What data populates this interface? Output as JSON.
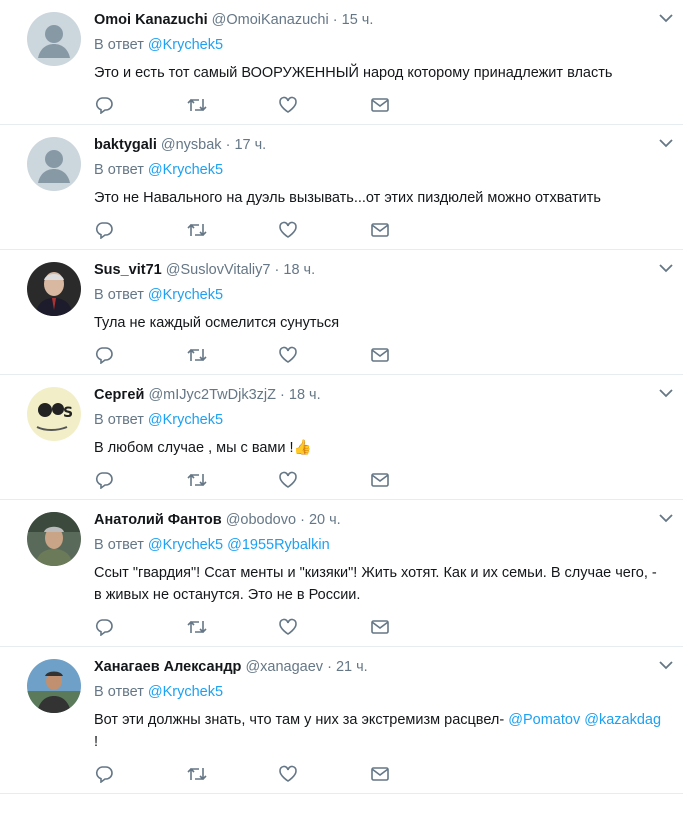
{
  "reply_prefix": "В ответ",
  "dot": "·",
  "tweets": [
    {
      "name": "Omoi Kanazuchi",
      "handle": "@OmoiKanazuchi",
      "time": "15 ч.",
      "mentions": [
        "@Krychek5"
      ],
      "text": "Это и есть тот самый ВООРУЖЕННЫЙ народ которому принадлежит власть",
      "text_mentions": []
    },
    {
      "name": "baktygali",
      "handle": "@nysbak",
      "time": "17 ч.",
      "mentions": [
        "@Krychek5"
      ],
      "text": "Это не Навального на дуэль вызывать...от этих пиздюлей можно отхватить",
      "text_mentions": []
    },
    {
      "name": "Sus_vit71",
      "handle": "@SuslovVitaliy7",
      "time": "18 ч.",
      "mentions": [
        "@Krychek5"
      ],
      "text": "Тула не каждый осмелится сунуться",
      "text_mentions": []
    },
    {
      "name": "Сергей",
      "handle": "@mIJyc2TwDjk3zjZ",
      "time": "18 ч.",
      "mentions": [
        "@Krychek5"
      ],
      "text": "В любом случае , мы с вами !👍",
      "text_mentions": []
    },
    {
      "name": "Анатолий Фантов",
      "handle": "@obodovo",
      "time": "20 ч.",
      "mentions": [
        "@Krychek5",
        "@1955Rybalkin"
      ],
      "text": "Ссыт \"гвардия\"! Ссат менты и \"кизяки\"! Жить хотят. Как и их семьи. В случае чего, - в живых не останутся. Это не в России.",
      "text_mentions": []
    },
    {
      "name": "Ханагаев Александр",
      "handle": "@xanagaev",
      "time": "21 ч.",
      "mentions": [
        "@Krychek5"
      ],
      "text": "Вот эти должны знать, что там у них за экстремизм расцвел- ",
      "text_mentions": [
        "@Pomatov",
        "@kazakdag"
      ],
      "text_end": " !"
    }
  ],
  "colors": {
    "accent": "#1da1f2",
    "muted": "#657786",
    "text": "#14171a",
    "border": "#e6ecf0"
  }
}
